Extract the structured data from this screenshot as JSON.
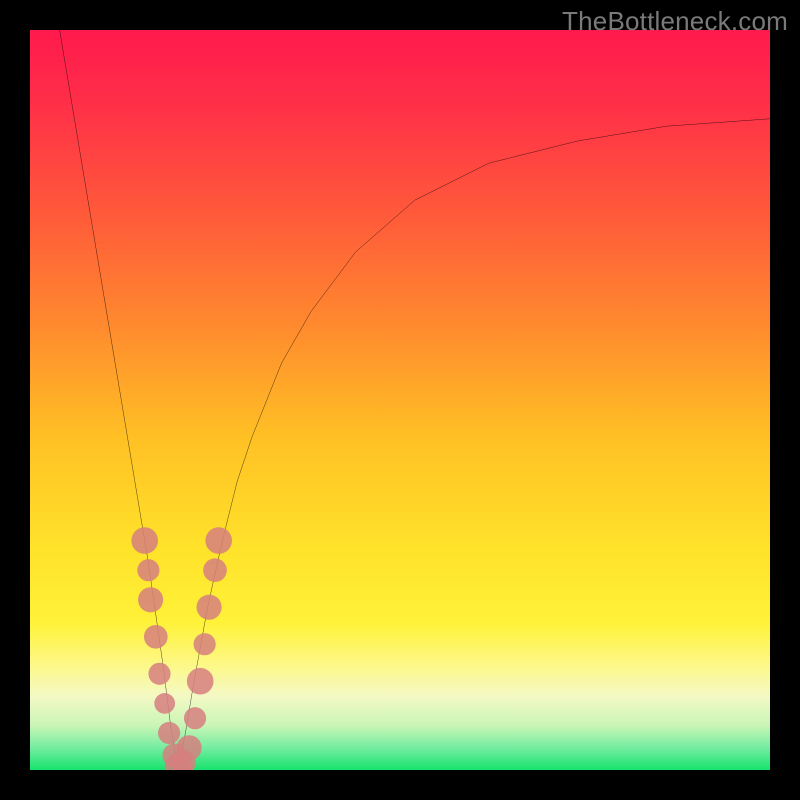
{
  "watermark": "TheBottleneck.com",
  "colors": {
    "frame": "#000000",
    "curve": "#000000",
    "marker": "#d67f7f",
    "gradient_stops": [
      {
        "offset": 0.0,
        "color": "#ff1a4d"
      },
      {
        "offset": 0.1,
        "color": "#ff2f48"
      },
      {
        "offset": 0.25,
        "color": "#ff5a3a"
      },
      {
        "offset": 0.4,
        "color": "#ff8a2e"
      },
      {
        "offset": 0.55,
        "color": "#ffc024"
      },
      {
        "offset": 0.7,
        "color": "#ffe22a"
      },
      {
        "offset": 0.8,
        "color": "#fff238"
      },
      {
        "offset": 0.86,
        "color": "#fdf88a"
      },
      {
        "offset": 0.9,
        "color": "#f4f9c4"
      },
      {
        "offset": 0.94,
        "color": "#c9f5b6"
      },
      {
        "offset": 0.97,
        "color": "#74eda0"
      },
      {
        "offset": 1.0,
        "color": "#17e36e"
      }
    ]
  },
  "chart_data": {
    "type": "line",
    "title": "",
    "xlabel": "",
    "ylabel": "",
    "xlim": [
      0,
      100
    ],
    "ylim": [
      0,
      100
    ],
    "note": "V-shaped bottleneck curve. y ≈ 100 is top (worst), y ≈ 0 is bottom (best). Minimum near x ≈ 20.",
    "series": [
      {
        "name": "bottleneck-curve",
        "x": [
          4,
          6,
          8,
          10,
          12,
          14,
          16,
          18,
          19,
          20,
          21,
          22,
          24,
          26,
          28,
          30,
          34,
          38,
          44,
          52,
          62,
          74,
          86,
          100
        ],
        "y": [
          100,
          88,
          76,
          64,
          52,
          40,
          28,
          14,
          6,
          0,
          5,
          11,
          22,
          31,
          39,
          45,
          55,
          62,
          70,
          77,
          82,
          85,
          87,
          88
        ]
      }
    ],
    "markers": {
      "name": "highlighted-points",
      "note": "salmon dots clustered around the minimum of the V",
      "points": [
        {
          "x": 15.5,
          "y": 31,
          "r": 1.8
        },
        {
          "x": 16.0,
          "y": 27,
          "r": 1.5
        },
        {
          "x": 16.3,
          "y": 23,
          "r": 1.7
        },
        {
          "x": 17.0,
          "y": 18,
          "r": 1.6
        },
        {
          "x": 17.5,
          "y": 13,
          "r": 1.5
        },
        {
          "x": 18.2,
          "y": 9,
          "r": 1.4
        },
        {
          "x": 18.8,
          "y": 5,
          "r": 1.5
        },
        {
          "x": 19.5,
          "y": 2,
          "r": 1.6
        },
        {
          "x": 20.0,
          "y": 0.5,
          "r": 1.8
        },
        {
          "x": 20.8,
          "y": 1,
          "r": 1.6
        },
        {
          "x": 21.5,
          "y": 3,
          "r": 1.7
        },
        {
          "x": 22.3,
          "y": 7,
          "r": 1.5
        },
        {
          "x": 23.0,
          "y": 12,
          "r": 1.8
        },
        {
          "x": 23.6,
          "y": 17,
          "r": 1.5
        },
        {
          "x": 24.2,
          "y": 22,
          "r": 1.7
        },
        {
          "x": 25.0,
          "y": 27,
          "r": 1.6
        },
        {
          "x": 25.5,
          "y": 31,
          "r": 1.8
        }
      ]
    }
  }
}
